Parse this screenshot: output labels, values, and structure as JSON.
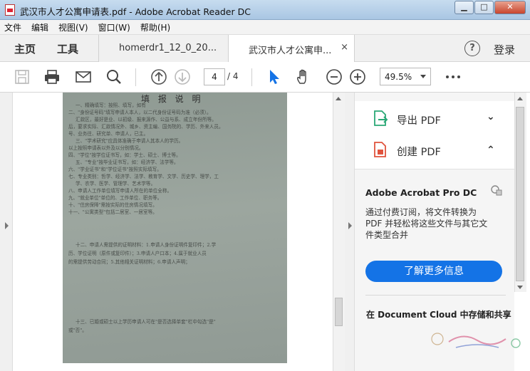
{
  "window": {
    "title": "武汉市人才公寓申请表.pdf - Adobe Acrobat Reader DC",
    "min": "▁",
    "max": "□",
    "close": "✕"
  },
  "menu": [
    "文件",
    "编辑",
    "视图(V)",
    "窗口(W)",
    "帮助(H)"
  ],
  "nav": {
    "home": "主页",
    "tools": "工具",
    "sign_in": "登录",
    "help": "?"
  },
  "tabs": [
    {
      "label": "homerdr1_12_0_20..."
    },
    {
      "label": "武汉市人才公寓申...",
      "close": "×"
    }
  ],
  "toolbar": {
    "current_page": "4",
    "total_pages": "/ 4",
    "zoom": "49.5%"
  },
  "document": {
    "heading": "填 报 说 明",
    "lines": [
      "一、精确填写：按照、填写，如有",
      "二、\"身份证号码\"填写申请人本人，以二代身份证号码为准（必须）。",
      "汇款区，最好是业、以初级、报来源作、公益与系、成立年份所等。",
      "后，要求实际、汇款情况外、城乡、资主编、国务院的、学历、外来人员。",
      "号、业务往、研究单、申请人，已主。",
      "三、\"学术研究\"应具体准确于申请人其本人的学历。",
      "以上按照申请表以外及以分别情况。",
      "四、\"学位\"按学位证书写，如：学士、硕士、博士等。",
      "五、\"专业\"按毕业证书写，如：经济学、法学等。",
      "六、\"学业证书\"和\"学位证书\"按照实际填写。",
      "七、专业类别：哲学、经济学、法学、教育学、文学、历史学、理学，工",
      "学、农学、医学、管理学、艺术学等。",
      "八、申请人工作单位填写申请人所在的单位全称。",
      "九、\"就业单位\"单位的、工作单位、职务等。",
      "十、\"住房保障\"需按实际的住房情况填写。",
      "十一、\"公寓类型\"包括二居室、一居室等。",
      "十二、申请人需提供的证明材料：1.申请人身份证明件复印件；2.学",
      "历、学位证明（原件或复印件）；3.申请人户口本；4.属于就业人员",
      "的需提供劳动合同；5.其他相关证明材料；6.申请人声明；",
      "十三、已婚或硕士以上学历申请人可在\"是否选择单套\"栏中勾选\"是\"",
      "或\"否\"。"
    ]
  },
  "right_pane": {
    "export_pdf": "导出 PDF",
    "create_pdf": "创建 PDF",
    "promo_title": "Adobe Acrobat Pro DC",
    "promo_text": "通过付费订阅，将文件转换为 PDF 并轻松将这些文件与其它文件类型合并",
    "promo_button": "了解更多信息",
    "cloud_title": "在 Document Cloud 中存储和共享"
  },
  "colors": {
    "accent": "#1473e6",
    "export_icon": "#2aa876",
    "create_icon": "#e0533d",
    "selection_tool": "#1473e6"
  }
}
